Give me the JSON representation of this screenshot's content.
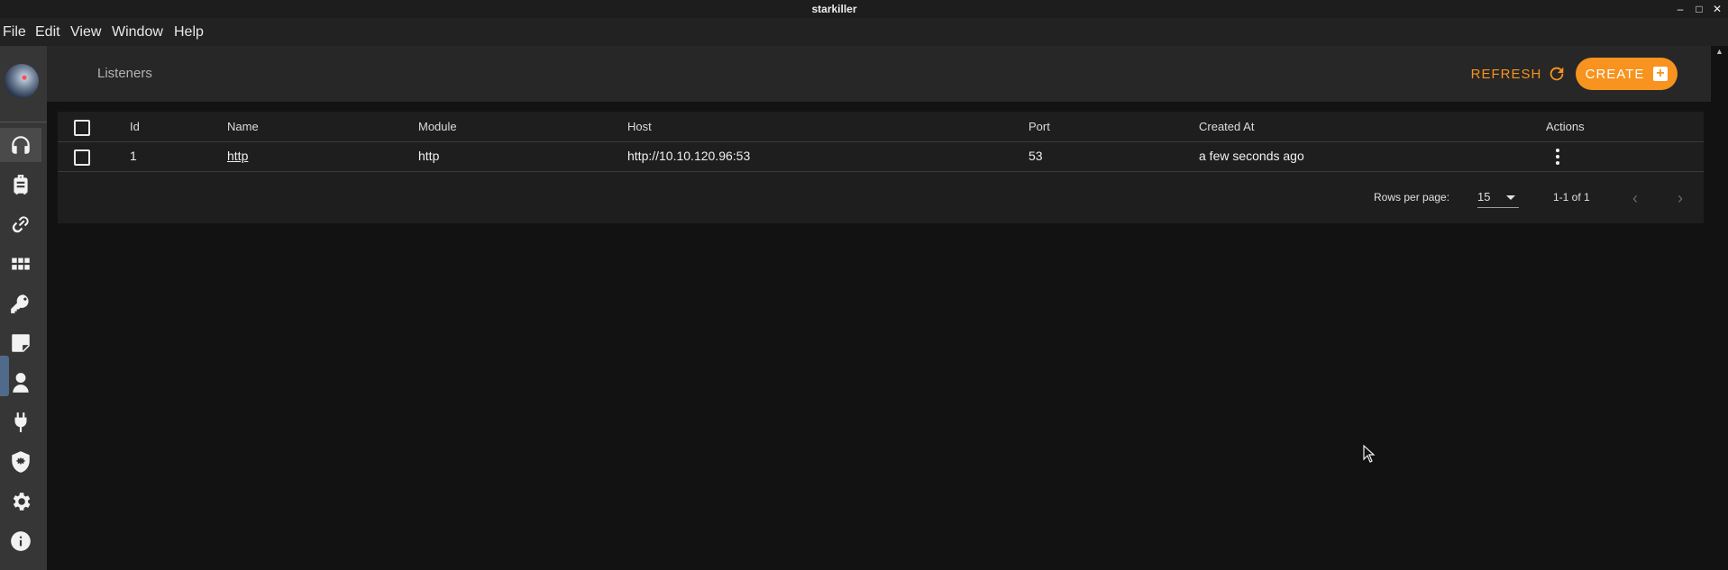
{
  "window": {
    "title": "starkiller",
    "minimize": "–",
    "maximize": "□",
    "close": "✕"
  },
  "menu": [
    "File",
    "Edit",
    "View",
    "Window",
    "Help"
  ],
  "sidebar": {
    "items": [
      {
        "icon": "headset-icon",
        "active": true
      },
      {
        "icon": "luggage-icon",
        "active": false
      },
      {
        "icon": "link-icon",
        "active": false
      },
      {
        "icon": "apps-grid-icon",
        "active": false
      },
      {
        "icon": "key-icon",
        "active": false
      },
      {
        "icon": "sticky-note-icon",
        "active": false
      },
      {
        "icon": "user-icon",
        "active": false
      },
      {
        "icon": "plug-icon",
        "active": false
      },
      {
        "icon": "shield-virus-icon",
        "active": false
      },
      {
        "icon": "gear-icon",
        "active": false
      },
      {
        "icon": "info-icon",
        "active": false
      }
    ]
  },
  "header": {
    "title": "Listeners",
    "refresh_label": "REFRESH",
    "create_label": "CREATE"
  },
  "table": {
    "columns": [
      "Id",
      "Name",
      "Module",
      "Host",
      "Port",
      "Created At",
      "Actions"
    ],
    "rows": [
      {
        "id": "1",
        "name": "http",
        "module": "http",
        "host": "http://10.10.120.96:53",
        "port": "53",
        "created_at": "a few seconds ago"
      }
    ],
    "footer": {
      "rows_per_page_label": "Rows per page:",
      "rows_per_page_value": "15",
      "range_text": "1-1 of 1",
      "prev": "‹",
      "next": "›"
    }
  },
  "colors": {
    "accent": "#f7931e",
    "background": "#121212",
    "surface": "#1e1e1e",
    "sidebar": "#363636"
  }
}
